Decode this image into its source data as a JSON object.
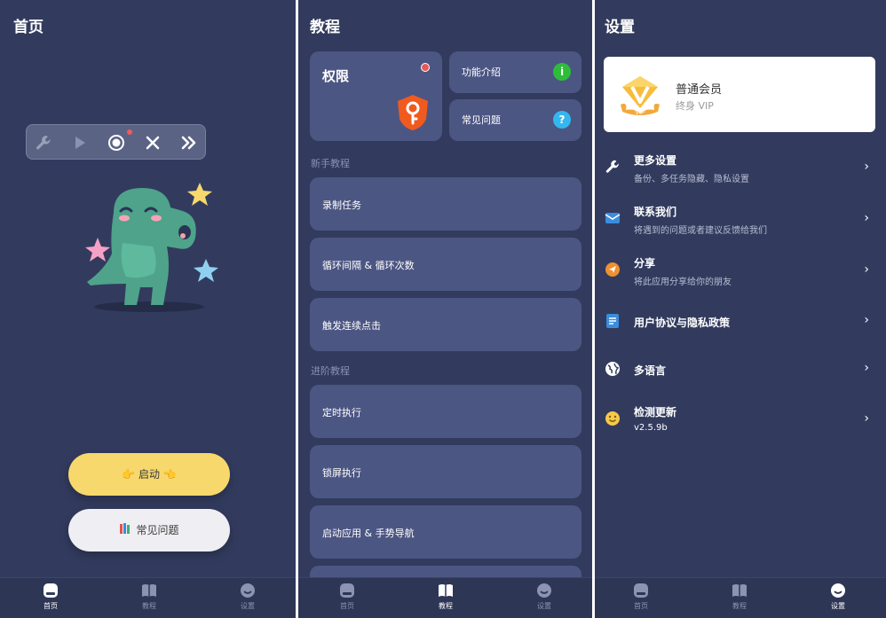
{
  "home": {
    "title": "首页",
    "toolbar_icons": [
      "wrench-icon",
      "play-icon",
      "record-icon",
      "close-icon",
      "fast-forward-icon"
    ],
    "start_button": "👉 启动 👈",
    "faq_button": "常见问题",
    "nav": [
      {
        "label": "首页",
        "icon": "home-icon",
        "active": true
      },
      {
        "label": "教程",
        "icon": "book-icon",
        "active": false
      },
      {
        "label": "设置",
        "icon": "settings-icon",
        "active": false
      }
    ]
  },
  "tutorial": {
    "title": "教程",
    "permission_card": "权限",
    "feature_intro": "功能介绍",
    "faq": "常见问题",
    "beginner_section": "新手教程",
    "beginner_items": [
      "录制任务",
      "循环间隔 & 循环次数",
      "触发连续点击"
    ],
    "advanced_section": "进阶教程",
    "advanced_items": [
      "定时执行",
      "锁屏执行",
      "启动应用 & 手势导航"
    ],
    "nav": [
      {
        "label": "首页",
        "icon": "home-icon",
        "active": false
      },
      {
        "label": "教程",
        "icon": "book-icon",
        "active": true
      },
      {
        "label": "设置",
        "icon": "settings-icon",
        "active": false
      }
    ]
  },
  "settings": {
    "title": "设置",
    "vip": {
      "title": "普通会员",
      "subtitle": "终身 VIP",
      "badge_text": "VIP"
    },
    "items": [
      {
        "icon": "wrench-icon",
        "title": "更多设置",
        "subtitle": "备份、多任务隐藏、隐私设置"
      },
      {
        "icon": "mail-icon",
        "title": "联系我们",
        "subtitle": "将遇到的问题或者建议反馈给我们"
      },
      {
        "icon": "share-icon",
        "title": "分享",
        "subtitle": "将此应用分享给你的朋友"
      },
      {
        "icon": "document-icon",
        "title": "用户协议与隐私政策",
        "subtitle": ""
      },
      {
        "icon": "globe-icon",
        "title": "多语言",
        "subtitle": ""
      },
      {
        "icon": "smiley-icon",
        "title": "检测更新",
        "subtitle": "v2.5.9b"
      }
    ],
    "nav": [
      {
        "label": "首页",
        "icon": "home-icon",
        "active": false
      },
      {
        "label": "教程",
        "icon": "book-icon",
        "active": false
      },
      {
        "label": "设置",
        "icon": "settings-icon",
        "active": true
      }
    ]
  },
  "colors": {
    "background": "#323b5e",
    "card": "#4c5683",
    "start_button": "#f7d86c",
    "accent_green": "#2ebd3a",
    "accent_cyan": "#33b7ef"
  }
}
